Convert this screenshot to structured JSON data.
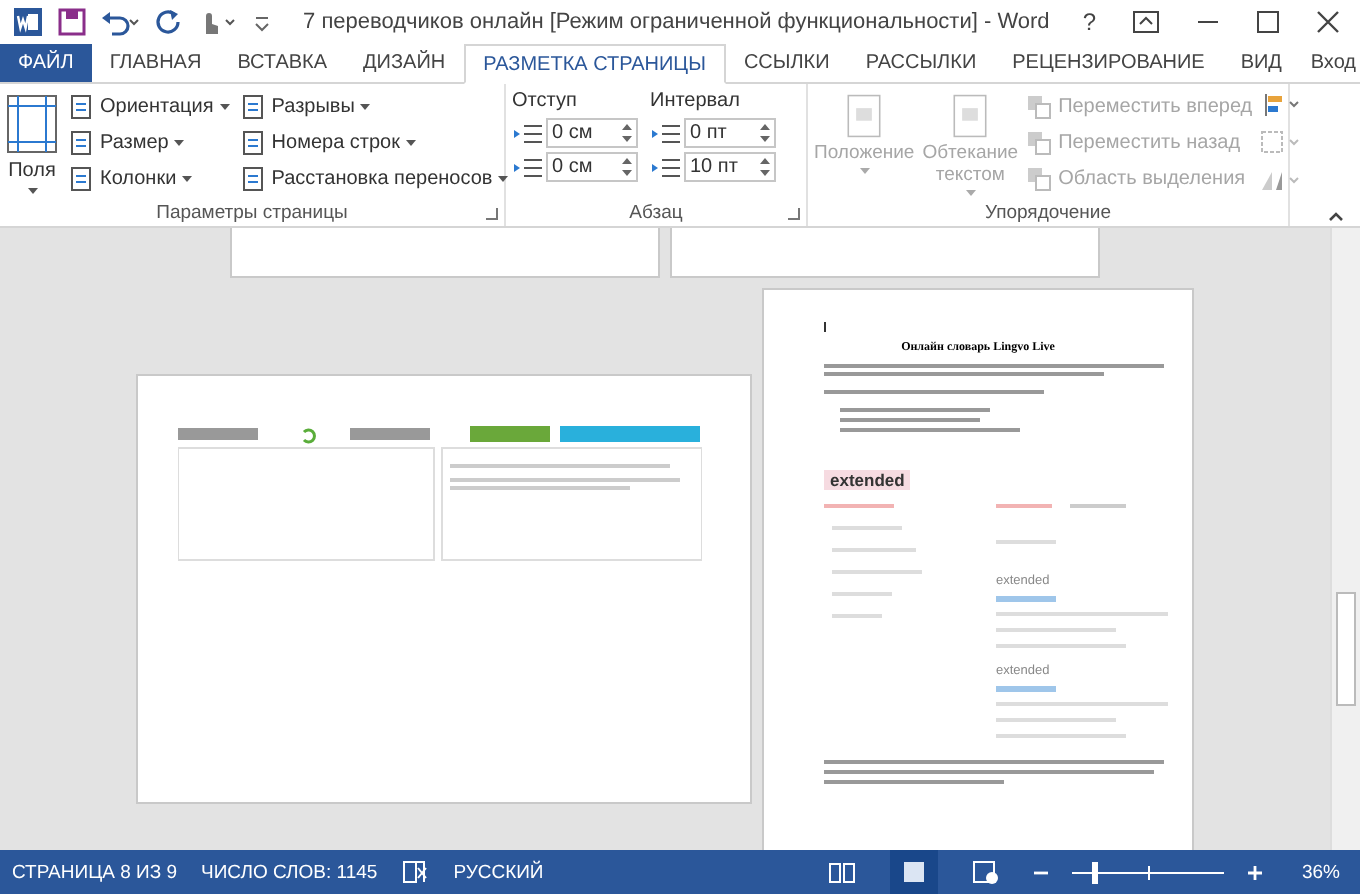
{
  "window": {
    "title": "7 переводчиков онлайн [Режим ограниченной функциональности] - Word",
    "help": "?"
  },
  "tabs": [
    {
      "label": "ФАЙЛ",
      "kind": "file",
      "selected": false
    },
    {
      "label": "ГЛАВНАЯ",
      "kind": "tab",
      "selected": false
    },
    {
      "label": "ВСТАВКА",
      "kind": "tab",
      "selected": false
    },
    {
      "label": "ДИЗАЙН",
      "kind": "tab",
      "selected": false
    },
    {
      "label": "РАЗМЕТКА СТРАНИЦЫ",
      "kind": "tab",
      "selected": true
    },
    {
      "label": "ССЫЛКИ",
      "kind": "tab",
      "selected": false
    },
    {
      "label": "РАССЫЛКИ",
      "kind": "tab",
      "selected": false
    },
    {
      "label": "РЕЦЕНЗИРОВАНИЕ",
      "kind": "tab",
      "selected": false
    },
    {
      "label": "ВИД",
      "kind": "tab",
      "selected": false
    }
  ],
  "account": {
    "label": "Вход"
  },
  "ribbon": {
    "page_setup": {
      "big_button": "Поля",
      "column_1": [
        "Ориентация",
        "Размер",
        "Колонки"
      ],
      "column_2": [
        "Разрывы",
        "Номера строк",
        "Расстановка переносов"
      ],
      "label": "Параметры страницы"
    },
    "paragraph": {
      "indent": {
        "heading": "Отступ",
        "fields": [
          "0 см",
          "0 см"
        ]
      },
      "spacing": {
        "heading": "Интервал",
        "fields": [
          "0 пт",
          "10 пт"
        ]
      },
      "label": "Абзац"
    },
    "arrange": {
      "disabled": true,
      "big_buttons": [
        "Положение",
        "Обтекание текстом"
      ],
      "small_buttons": [
        "Переместить вперед",
        "Переместить назад",
        "Область выделения"
      ],
      "label": "Упорядочение"
    }
  },
  "document": {
    "heading": "Онлайн словарь Lingvo Live",
    "highlighted_word": "extended",
    "entries": [
      "extended",
      "extended"
    ]
  },
  "status_bar": {
    "page": "СТРАНИЦА 8 ИЗ 9",
    "words": "ЧИСЛО СЛОВ: 1145",
    "language": "РУССКИЙ",
    "views": [
      {
        "kind": "read",
        "selected": false
      },
      {
        "kind": "print",
        "selected": true
      },
      {
        "kind": "web",
        "selected": false
      }
    ],
    "zoom": {
      "level": 0.15,
      "reading": "36%"
    }
  }
}
